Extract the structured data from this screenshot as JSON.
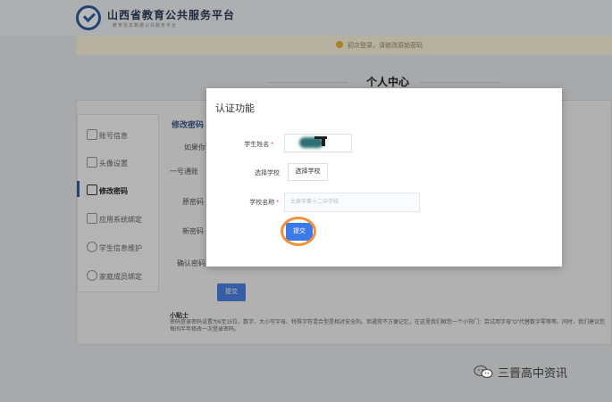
{
  "brand": {
    "title": "山西省教育公共服务平台",
    "subtitle": "教育信息数据公共服务平台"
  },
  "notice": {
    "text": "初次登录，请修改原始密码"
  },
  "header": {
    "title": "个人中心"
  },
  "sidebar": {
    "items": [
      {
        "label": "账号信息",
        "icon": "id-card-icon"
      },
      {
        "label": "头像设置",
        "icon": "portrait-icon"
      },
      {
        "label": "修改密码",
        "icon": "lock-icon",
        "active": true
      },
      {
        "label": "应用系统绑定",
        "icon": "apps-grid-icon"
      },
      {
        "label": "学生信息维护",
        "icon": "student-icon"
      },
      {
        "label": "家庭成员绑定",
        "icon": "family-icon"
      }
    ]
  },
  "content": {
    "title": "修改密码",
    "labels": [
      "如果你",
      "一号通账",
      "原密码",
      "新密码",
      "确认密码"
    ],
    "submit_label": "提交",
    "tip_title": "小贴士",
    "tip_text": "密码登录密码设置为6至15位，数字、大小写字母、特殊字符混合型是相对安全的。但通常不方便记忆，在这里我们献您一个小窍门：尝试用字母\"O\"代替数字零等等。同时，我们建议您每间半年修改一次登录密码。"
  },
  "dialog": {
    "title": "认证功能",
    "student_name_label": "学生姓名",
    "choose_school_label": "选择学校",
    "choose_school_button": "选择学校",
    "school_name_label": "学校名称",
    "school_name_placeholder": "太原市第十二中学校",
    "submit_label": "提交"
  },
  "watermark": {
    "text": "三晋高中资讯"
  },
  "colors": {
    "accent": "#3b7ae8",
    "highlight_ring": "#f0923a",
    "required": "#e34"
  }
}
